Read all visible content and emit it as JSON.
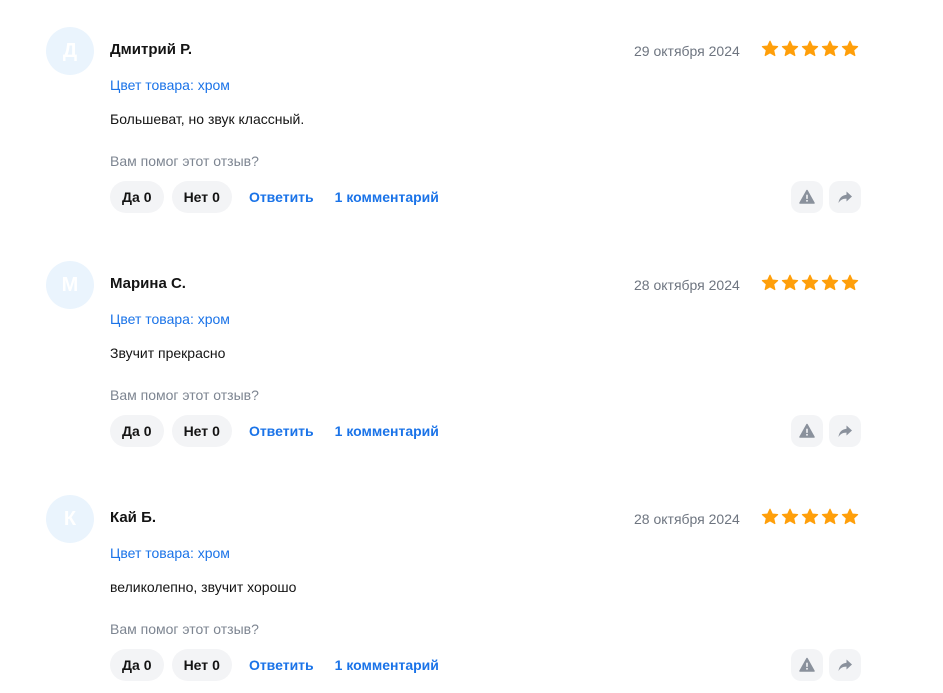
{
  "colors": {
    "accent": "#1a73e8",
    "star": "#ff9f0a",
    "avatar_bg": "#eaf4fd",
    "muted": "#7d8591",
    "button_bg": "#f3f4f6"
  },
  "reviews": [
    {
      "initial": "Д",
      "author": "Дмитрий Р.",
      "date": "29 октября 2024",
      "rating": 5,
      "variant": "Цвет товара: хром",
      "text": "Большеват, но звук классный.",
      "helpful_prompt": "Вам помог этот отзыв?",
      "yes_label": "Да",
      "yes_count": "0",
      "no_label": "Нет",
      "no_count": "0",
      "reply_label": "Ответить",
      "comments_label": "1 комментарий",
      "report_icon": "warning-icon",
      "share_icon": "share-arrow-icon"
    },
    {
      "initial": "М",
      "author": "Марина С.",
      "date": "28 октября 2024",
      "rating": 5,
      "variant": "Цвет товара: хром",
      "text": "Звучит прекрасно",
      "helpful_prompt": "Вам помог этот отзыв?",
      "yes_label": "Да",
      "yes_count": "0",
      "no_label": "Нет",
      "no_count": "0",
      "reply_label": "Ответить",
      "comments_label": "1 комментарий",
      "report_icon": "warning-icon",
      "share_icon": "share-arrow-icon"
    },
    {
      "initial": "К",
      "author": "Кай Б.",
      "date": "28 октября 2024",
      "rating": 5,
      "variant": "Цвет товара: хром",
      "text": "великолепно, звучит хорошо",
      "helpful_prompt": "Вам помог этот отзыв?",
      "yes_label": "Да",
      "yes_count": "0",
      "no_label": "Нет",
      "no_count": "0",
      "reply_label": "Ответить",
      "comments_label": "1 комментарий",
      "report_icon": "warning-icon",
      "share_icon": "share-arrow-icon"
    }
  ]
}
